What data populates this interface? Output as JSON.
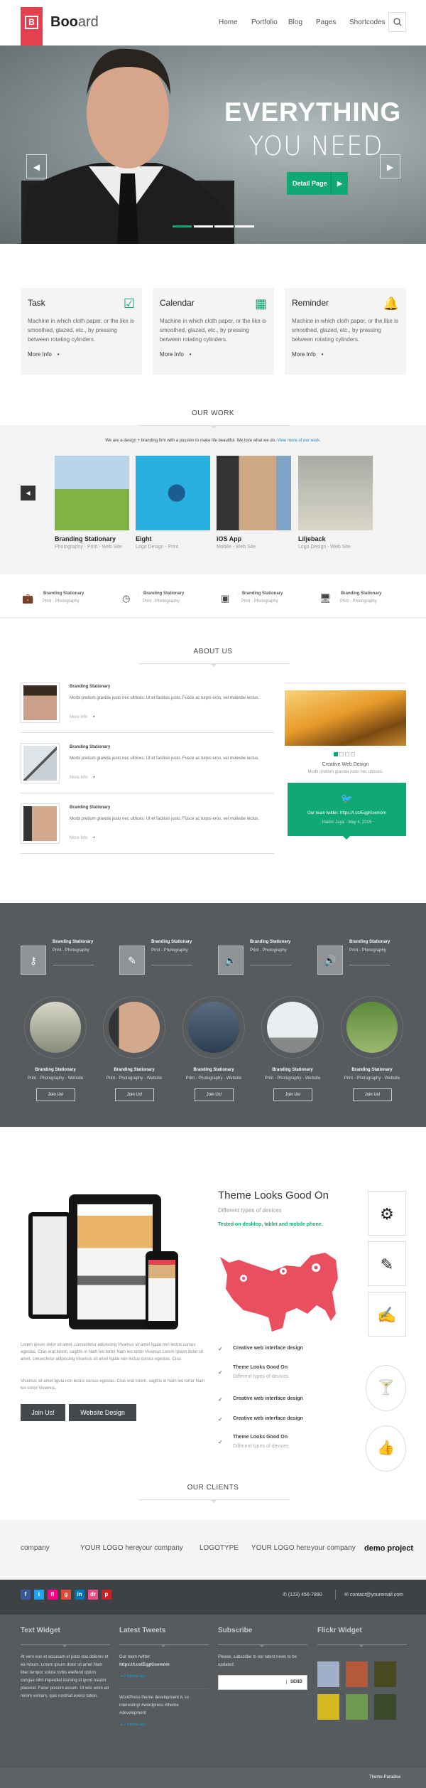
{
  "header": {
    "logo_letter": "B",
    "brand_bold": "Boo",
    "brand_light": "ard",
    "nav": [
      "Home",
      "Portfolio",
      "Blog",
      "Pages",
      "Shortcodes"
    ],
    "search_icon": "search-icon"
  },
  "hero": {
    "title": "EVERYTHING",
    "subtitle": "YOU NEED",
    "button": "Detail Page",
    "slides": 4,
    "active_slide": 1
  },
  "features": [
    {
      "title": "Task",
      "icon": "checkbox-icon",
      "text": "Machine in which cloth paper, or the like is smoothed, glazed, etc., by pressing between rotating cylinders.",
      "more": "More Info"
    },
    {
      "title": "Calendar",
      "icon": "calendar-icon",
      "text": "Machine in which cloth paper, or the like is smoothed, glazed, etc., by pressing between rotating cylinders.",
      "more": "More Info"
    },
    {
      "title": "Reminder",
      "icon": "bell-icon",
      "text": "Machine in which cloth paper, or the like is smoothed, glazed, etc., by pressing between rotating cylinders.",
      "more": "More Info"
    }
  ],
  "our_work": {
    "title": "OUR WORK",
    "tagline": "We are a design + branding firm with a passion to make life beautiful. We love what we do.",
    "tagline_link": "View more of our work.",
    "items": [
      {
        "title": "Branding Stationary",
        "sub": "Photography - Print - Web Site"
      },
      {
        "title": "Eight",
        "sub": "Logo Design - Print"
      },
      {
        "title": "iOS App",
        "sub": "Mobile - Web Site"
      },
      {
        "title": "Liljeback",
        "sub": "Logo Design - Web Site"
      }
    ]
  },
  "services": [
    {
      "icon": "briefcase-icon",
      "title": "Branding Stationary",
      "sub": "Print - Photography"
    },
    {
      "icon": "clock-icon",
      "title": "Branding Stationary",
      "sub": "Print - Photography"
    },
    {
      "icon": "twitch-icon",
      "title": "Branding Stationary",
      "sub": "Print - Photography"
    },
    {
      "icon": "monitor-icon",
      "title": "Branding Stationary",
      "sub": "Print - Photography"
    }
  ],
  "about": {
    "title": "ABOUT US",
    "items": [
      {
        "title": "Branding Stationary",
        "text": "Morbi pretium gravida justo nec ultrices. Ut et facilisis justo. Fusce ac turpis eros, vel molestie lectus.",
        "more": "More Info"
      },
      {
        "title": "Branding Stationary",
        "text": "Morbi pretium gravida justo nec ultrices. Ut et facilisis justo. Fusce ac turpis eros, vel molestie lectus.",
        "more": "More Info"
      },
      {
        "title": "Branding Stationary",
        "text": "Morbi pretium gravida justo nec ultrices. Ut et facilisis justo. Fusce ac turpis eros, vel molestie lectus.",
        "more": "More Info"
      }
    ],
    "slider": {
      "caption": "Creative Web Design",
      "text": "Morbi pretium gravida justo nec ultrices.",
      "slides": 4,
      "active": 1
    },
    "twitter": {
      "text": "Our team twitter: https://t.co/EqgKisemóm",
      "meta": "Hakim Jaya - May 4, 2015"
    }
  },
  "dark": {
    "features": [
      {
        "icon": "key-icon",
        "title": "Branding Stationary",
        "sub": "Print - Photography"
      },
      {
        "icon": "pencil-icon",
        "title": "Branding Stationary",
        "sub": "Print - Photography"
      },
      {
        "icon": "volume-low-icon",
        "title": "Branding Stationary",
        "sub": "Print - Photography"
      },
      {
        "icon": "volume-high-icon",
        "title": "Branding Stationary",
        "sub": "Print - Photography"
      }
    ],
    "team": [
      {
        "title": "Branding Stationary",
        "sub": "Print - Photography - Website",
        "button": "Join Us!"
      },
      {
        "title": "Branding Stationary",
        "sub": "Print - Photography - Website",
        "button": "Join Us!"
      },
      {
        "title": "Branding Stationary",
        "sub": "Print - Photography - Website",
        "button": "Join Us!"
      },
      {
        "title": "Branding Stationary",
        "sub": "Print - Photography - Website",
        "button": "Join Us!"
      },
      {
        "title": "Branding Stationary",
        "sub": "Print - Photography - Website",
        "button": "Join Us!"
      }
    ]
  },
  "devices": {
    "title": "Theme Looks Good On",
    "subtitle": "Different types of devices",
    "highlight": "Tested on desktop, tablet and mobile phone.",
    "para1": "Lorem ipsum dolor sit amet, consectetur adipiscing Vivamus sit amet ligula non lectus cursus egestas. Cras erat lorem, sagittis in Nam leo tortor Nam leo tortor Vivamus Lorem ipsum dolor sit amet, consectetur adipiscing Vivamus sit amet ligula non lectus cursus egestas. Cras",
    "para2": "Vivamus sit amet ligula non lectus cursus egestas. Cras erat lorem, sagittis in Nam leo tortor Nam leo tortor Vivamus.",
    "buttons": [
      "Join Us!",
      "Website Design"
    ],
    "checklist": [
      {
        "title": "Creative web interface design",
        "sub": ""
      },
      {
        "title": "Theme Looks Good On",
        "sub": "Different types of devices"
      },
      {
        "title": "Creative web interface design",
        "sub": ""
      },
      {
        "title": "Creative web interface design",
        "sub": ""
      },
      {
        "title": "Theme Looks Good On",
        "sub": "Different types of devices"
      }
    ],
    "side_icons": [
      "gear-icon",
      "pencil-icon",
      "edit-icon",
      "cocktail-icon",
      "thumbs-up-icon"
    ],
    "map_color": "#e94f5f"
  },
  "clients": {
    "title": "OUR CLIENTS",
    "logos": [
      "company",
      "YOUR LOGO here",
      "your company",
      "LOGOTYPE",
      "YOUR LOGO here",
      "your company",
      "demo project"
    ]
  },
  "footer": {
    "social": [
      "f",
      "t",
      "fl",
      "g",
      "in",
      "dr",
      "p"
    ],
    "social_colors": [
      "#3b5998",
      "#1da1f2",
      "#ff0084",
      "#dd4b39",
      "#0077b5",
      "#ea4c89",
      "#cb2027"
    ],
    "phone": "(123) 456-7890",
    "email": "contact@youremail.com",
    "widgets": {
      "text": {
        "title": "Text Widget",
        "body": "At vero eos et accusam et justo duo dolores et ea rebum. Lorem ipsum dolor sit amet Nam liber tempor soluta nobis eleifend option congue nihil imperdiet doming id quod mazim placerat. Facer possim assum. Ut wisi enim ad minim veniam, quis nostrud exerci tation."
      },
      "tweets": {
        "title": "Latest Tweets",
        "t1": "Our team twitter:",
        "t1_link": "https://t.co/EqgKisemóm",
        "t1_time": "2 months ago",
        "t2": "WordPress theme development is so interesting! #wordpress #theme #development",
        "t2_time": "2 months ago"
      },
      "subscribe": {
        "title": "Subscribe",
        "text": "Please, subscribe to our latest news to be updated.",
        "placeholder": "",
        "button": "SEND"
      },
      "flickr": {
        "title": "Flickr Widget"
      }
    },
    "credit": "Theme-Paradise"
  },
  "colors": {
    "accent": "#10a874",
    "brand": "#e5404f",
    "dark": "#575b5e"
  }
}
